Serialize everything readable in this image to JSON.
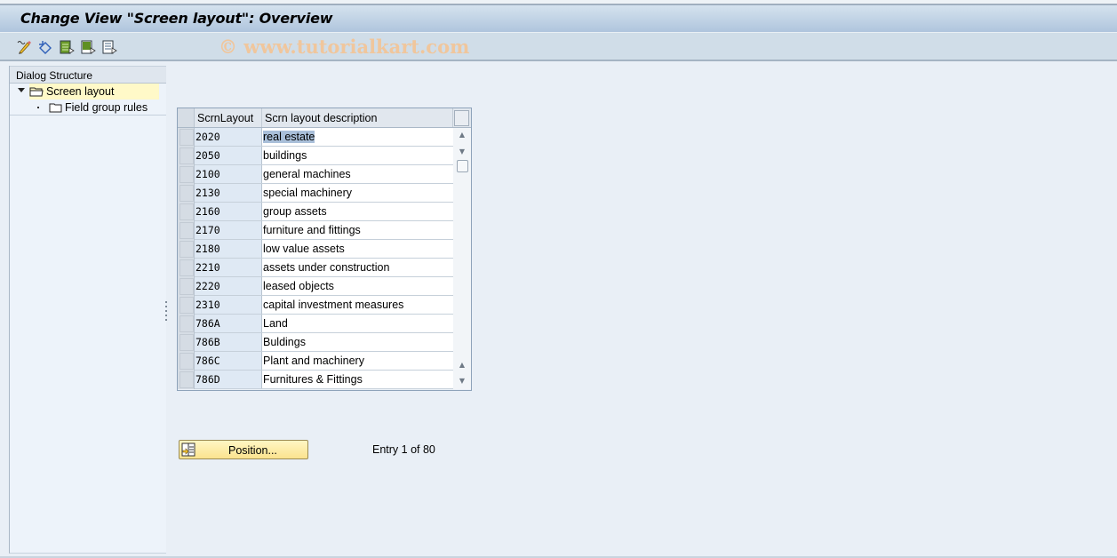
{
  "window": {
    "title": "Change View \"Screen layout\": Overview",
    "watermark": "© www.tutorialkart.com"
  },
  "toolbar": {
    "icons": [
      {
        "name": "display-change-icon",
        "tooltip": "Display -> Change"
      },
      {
        "name": "undo-icon",
        "tooltip": "Undo change"
      },
      {
        "name": "select-all-icon",
        "tooltip": "Select All"
      },
      {
        "name": "select-block-icon",
        "tooltip": "Select Block"
      },
      {
        "name": "deselect-all-icon",
        "tooltip": "Deselect All"
      }
    ]
  },
  "dialog_structure": {
    "header": "Dialog Structure",
    "items": [
      {
        "label": "Screen layout",
        "level": 0,
        "expanded": true,
        "selected": true
      },
      {
        "label": "Field group rules",
        "level": 1,
        "expanded": false,
        "selected": false
      }
    ]
  },
  "table": {
    "columns": [
      "ScrnLayout",
      "Scrn layout description"
    ],
    "rows": [
      {
        "key": "2020",
        "desc": "real estate"
      },
      {
        "key": "2050",
        "desc": "buildings"
      },
      {
        "key": "2100",
        "desc": "general machines"
      },
      {
        "key": "2130",
        "desc": "special machinery"
      },
      {
        "key": "2160",
        "desc": "group assets"
      },
      {
        "key": "2170",
        "desc": "furniture and fittings"
      },
      {
        "key": "2180",
        "desc": "low value assets"
      },
      {
        "key": "2210",
        "desc": "assets under construction"
      },
      {
        "key": "2220",
        "desc": "leased objects"
      },
      {
        "key": "2310",
        "desc": "capital investment measures"
      },
      {
        "key": "786A",
        "desc": "Land"
      },
      {
        "key": "786B",
        "desc": "Buldings"
      },
      {
        "key": "786C",
        "desc": "Plant and machinery"
      },
      {
        "key": "786D",
        "desc": "Furnitures & Fittings"
      }
    ],
    "highlighted_row": 0
  },
  "footer": {
    "position_button": "Position...",
    "entry_text": "Entry 1 of 80"
  }
}
